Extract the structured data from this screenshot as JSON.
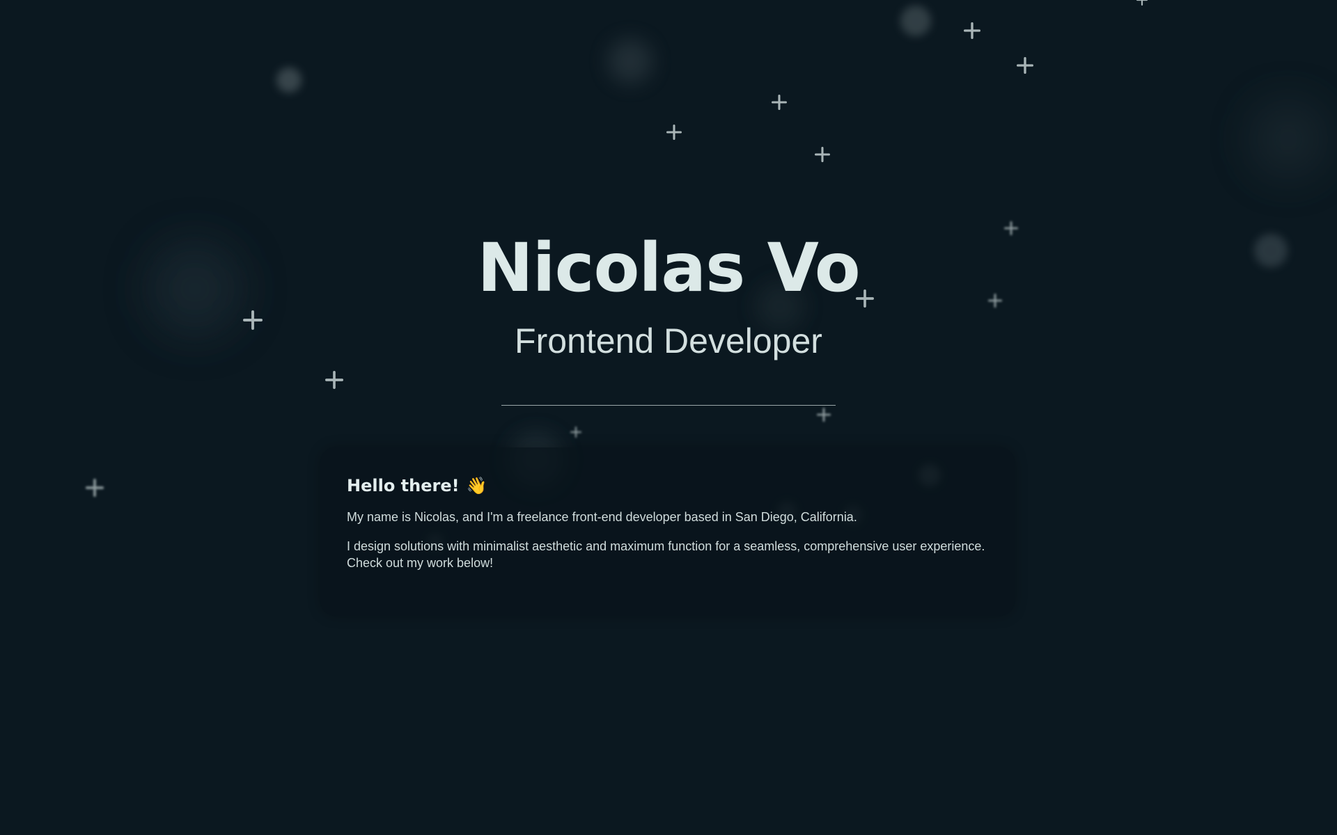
{
  "hero": {
    "name": "Nicolas Vo",
    "role": "Frontend Developer"
  },
  "intro": {
    "heading": "Hello there!",
    "wave_emoji": "👋",
    "paragraph_1": "My name is Nicolas, and I'm a freelance front-end developer based in San Diego, California.",
    "paragraph_2": "I design solutions with minimalist aesthetic and maximum function for a seamless, comprehensive user experience. Check out my work below!"
  },
  "theme": {
    "background": "#0b1820",
    "text": "#dce9e8",
    "star": "#aab6b8"
  }
}
